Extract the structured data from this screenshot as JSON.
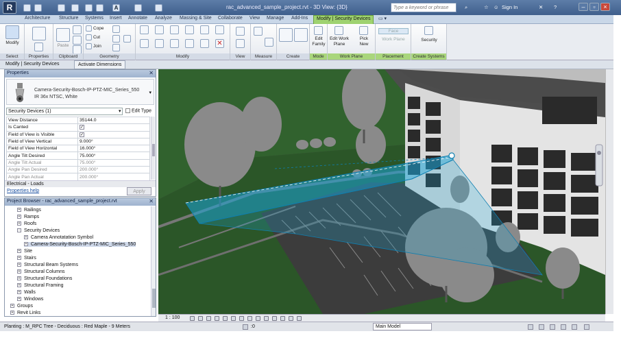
{
  "title_bar": {
    "title": "rac_advanced_sample_project.rvt - 3D View: {3D}",
    "search_placeholder": "Type a keyword or phrase",
    "sign_in": "Sign In"
  },
  "tabs": [
    "Architecture",
    "Structure",
    "Systems",
    "Insert",
    "Annotate",
    "Analyze",
    "Massing & Site",
    "Collaborate",
    "View",
    "Manage",
    "Add-Ins",
    "Modify | Security Devices"
  ],
  "active_tab": "Modify | Security Devices",
  "ribbon": {
    "groups": [
      "Select",
      "Properties",
      "Clipboard",
      "Geometry",
      "Modify",
      "View",
      "Measure",
      "Create",
      "Mode",
      "Work Plane",
      "Placement",
      "Create Systems"
    ],
    "modify_label": "Modify",
    "paste_label": "Paste",
    "cope_label": "Cope",
    "cut_label": "Cut",
    "join_label": "Join",
    "edit_family": "Edit Family",
    "edit_work_plane": "Edit Work Plane",
    "pick_new": "Pick New",
    "face_label": "Face",
    "work_plane_label": "Work Plane",
    "security_label": "Security"
  },
  "context_bar": {
    "label": "Modify | Security Devices",
    "button": "Activate Dimensions"
  },
  "properties": {
    "header": "Properties",
    "type_name_1": "Camera-Security-Bosch-IP-PTZ-MIC_Series_550",
    "type_name_2": "IR 36x NTSC, White",
    "selector": "Security Devices (1)",
    "edit_type": "Edit Type",
    "rows": [
      {
        "k": "View Distance",
        "v": "35144.0"
      },
      {
        "k": "Is Canted",
        "v": "✓"
      },
      {
        "k": "Field of View is Visible",
        "v": "✓"
      },
      {
        "k": "Field of View Vertical",
        "v": "9.000°"
      },
      {
        "k": "Field of View Horizontal",
        "v": "16.000°"
      },
      {
        "k": "Angle Tilt Desired",
        "v": "75.000°"
      },
      {
        "k": "Angle Tilt Actual",
        "v": "75.000°"
      },
      {
        "k": "Angle Pan Desired",
        "v": "200.000°"
      },
      {
        "k": "Angle Pan Actual",
        "v": "200.000°"
      }
    ],
    "electrical": "Electrical - Loads",
    "help": "Properties help",
    "apply": "Apply"
  },
  "browser": {
    "header": "Project Browser - rac_advanced_sample_project.rvt",
    "items": [
      {
        "label": "Railings",
        "level": 1,
        "pm": "+"
      },
      {
        "label": "Ramps",
        "level": 1,
        "pm": "+"
      },
      {
        "label": "Roofs",
        "level": 1,
        "pm": "+"
      },
      {
        "label": "Security Devices",
        "level": 1,
        "pm": "-"
      },
      {
        "label": "Camera Annotatation Symbol",
        "level": 2,
        "pm": "+"
      },
      {
        "label": "Camera-Security-Bosch-IP-PTZ-MIC_Series_550",
        "level": 2,
        "pm": "+"
      },
      {
        "label": "Site",
        "level": 1,
        "pm": "+"
      },
      {
        "label": "Stairs",
        "level": 1,
        "pm": "+"
      },
      {
        "label": "Structural Beam Systems",
        "level": 1,
        "pm": "+"
      },
      {
        "label": "Structural Columns",
        "level": 1,
        "pm": "+"
      },
      {
        "label": "Structural Foundations",
        "level": 1,
        "pm": "+"
      },
      {
        "label": "Structural Framing",
        "level": 1,
        "pm": "+"
      },
      {
        "label": "Walls",
        "level": 1,
        "pm": "+"
      },
      {
        "label": "Windows",
        "level": 1,
        "pm": "+"
      },
      {
        "label": "Groups",
        "level": 0,
        "pm": "+"
      },
      {
        "label": "Revit Links",
        "level": 0,
        "pm": "+"
      }
    ]
  },
  "view_control": {
    "scale": "1 : 100"
  },
  "status_bar": {
    "text": "Planting : M_RPC Tree - Deciduous : Red Maple - 9 Meters",
    "model": "Main Model",
    "zero": ":0"
  },
  "colors": {
    "accent_green": "#9fd270",
    "fov_blue": "#1aa6d8",
    "title_blue": "#4a6a96"
  }
}
